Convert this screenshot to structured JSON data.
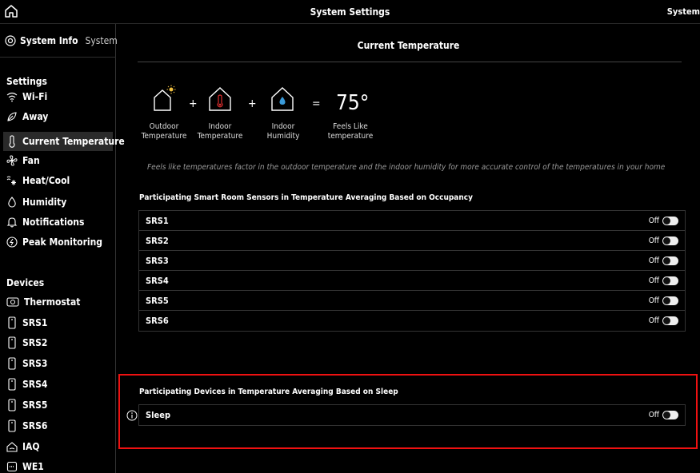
{
  "topbar": {
    "title": "System Settings",
    "right_text": "System"
  },
  "sidebar": {
    "system_info": {
      "label": "System Info",
      "sub": "System"
    },
    "settings_heading": "Settings",
    "settings_items": [
      {
        "label": "Wi-Fi",
        "icon": "wifi-icon"
      },
      {
        "label": "Away",
        "icon": "away-icon"
      },
      {
        "label": "Current Temperature",
        "icon": "thermometer-icon"
      },
      {
        "label": "Fan",
        "icon": "fan-icon"
      },
      {
        "label": "Heat/Cool",
        "icon": "heat-cool-icon"
      },
      {
        "label": "Humidity",
        "icon": "drop-icon"
      },
      {
        "label": "Notifications",
        "icon": "bell-icon"
      },
      {
        "label": "Peak Monitoring",
        "icon": "peak-icon"
      }
    ],
    "devices_heading": "Devices",
    "device_items": [
      {
        "label": "Thermostat",
        "icon": "thermostat-icon"
      },
      {
        "label": "SRS1",
        "icon": "sensor-icon"
      },
      {
        "label": "SRS2",
        "icon": "sensor-icon"
      },
      {
        "label": "SRS3",
        "icon": "sensor-icon"
      },
      {
        "label": "SRS4",
        "icon": "sensor-icon"
      },
      {
        "label": "SRS5",
        "icon": "sensor-icon"
      },
      {
        "label": "SRS6",
        "icon": "sensor-icon"
      },
      {
        "label": "IAQ",
        "icon": "iaq-icon"
      },
      {
        "label": "WE1",
        "icon": "we1-icon"
      }
    ]
  },
  "main": {
    "title": "Current Temperature",
    "formula": {
      "plus": "+",
      "equals": "=",
      "value": "75°",
      "captions": [
        {
          "line1": "Outdoor",
          "line2": "Temperature"
        },
        {
          "line1": "Indoor",
          "line2": "Temperature"
        },
        {
          "line1": "Indoor",
          "line2": "Humidity"
        },
        {
          "line1": "Feels Like",
          "line2": "temperature"
        }
      ]
    },
    "note": "Feels like temperatures factor in the outdoor temperature and the indoor humidity for more accurate control of the temperatures in your home",
    "occupancy": {
      "label": "Participating Smart Room Sensors in Temperature Averaging Based on Occupancy",
      "rows": [
        {
          "name": "SRS1",
          "state": "Off"
        },
        {
          "name": "SRS2",
          "state": "Off"
        },
        {
          "name": "SRS3",
          "state": "Off"
        },
        {
          "name": "SRS4",
          "state": "Off"
        },
        {
          "name": "SRS5",
          "state": "Off"
        },
        {
          "name": "SRS6",
          "state": "Off"
        }
      ]
    },
    "sleep": {
      "label": "Participating Devices in Temperature Averaging Based on Sleep",
      "rows": [
        {
          "name": "Sleep",
          "state": "Off"
        }
      ]
    }
  },
  "colors": {
    "background": "#000000",
    "highlight": "#e11111",
    "row_border": "#333333"
  }
}
